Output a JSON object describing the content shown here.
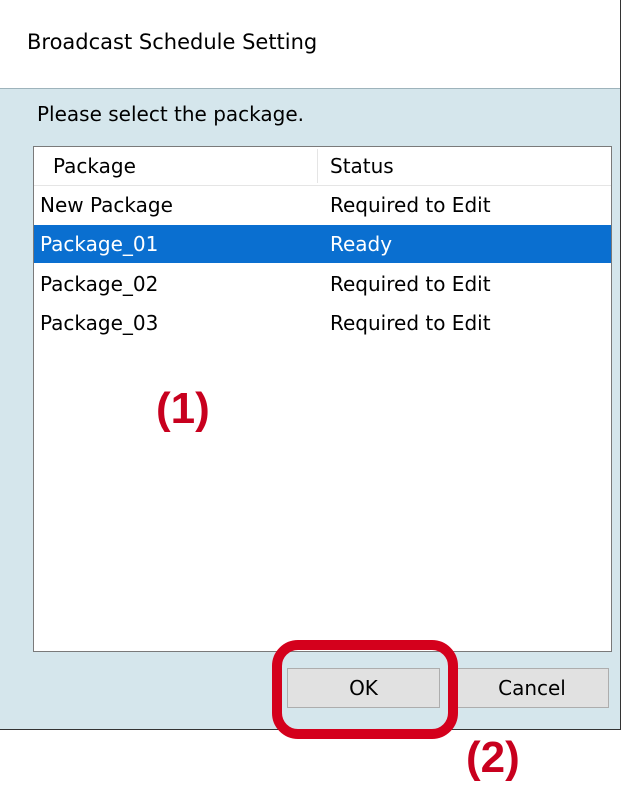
{
  "window": {
    "title": "Broadcast Schedule Setting"
  },
  "prompt": "Please select the package.",
  "list": {
    "columns": [
      "Package",
      "Status"
    ],
    "rows": [
      {
        "package": "New Package",
        "status": "Required to Edit",
        "selected": false
      },
      {
        "package": "Package_01",
        "status": "Ready",
        "selected": true
      },
      {
        "package": "Package_02",
        "status": "Required to Edit",
        "selected": false
      },
      {
        "package": "Package_03",
        "status": "Required to Edit",
        "selected": false
      }
    ]
  },
  "buttons": {
    "ok": "OK",
    "cancel": "Cancel"
  },
  "annotations": {
    "label_1": "(1)",
    "label_2": "(2)"
  },
  "colors": {
    "selection": "#0a6fd0",
    "annotation": "#c8001e",
    "dialog_bg": "#d5e6ec"
  }
}
